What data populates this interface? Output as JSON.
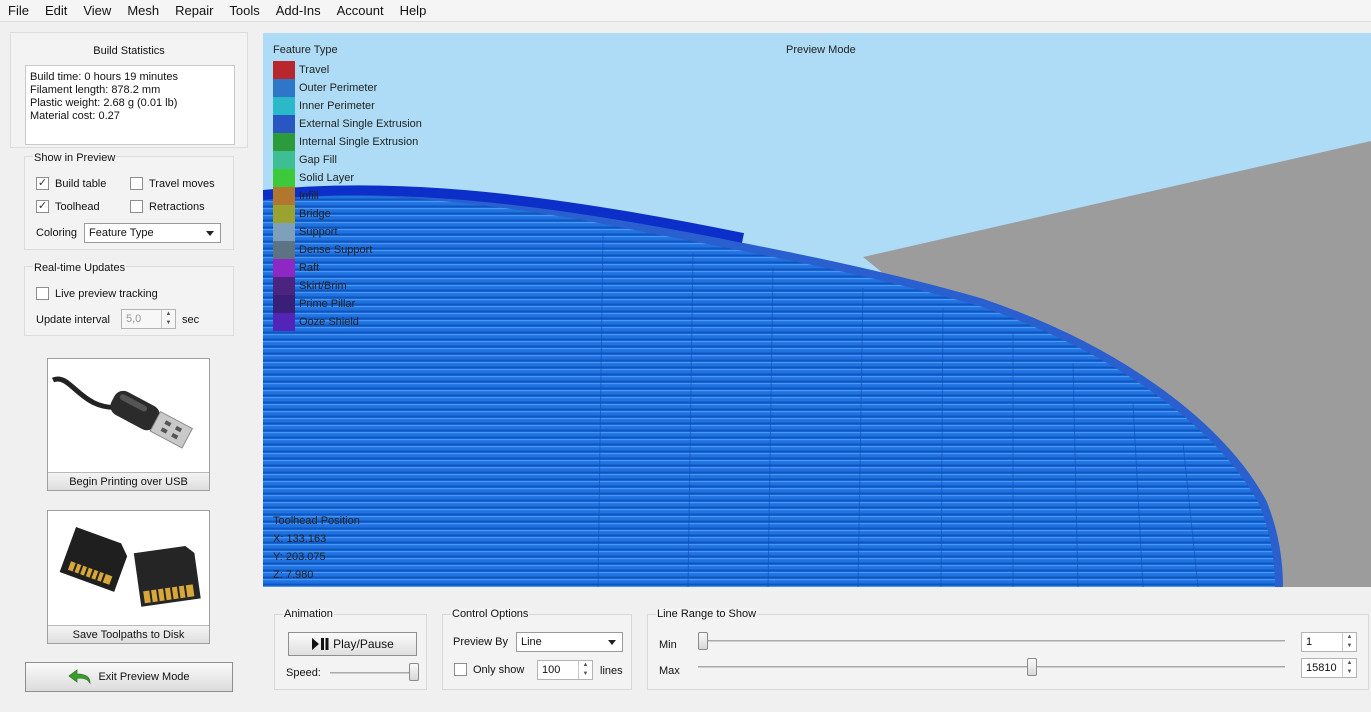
{
  "menu": [
    "File",
    "Edit",
    "View",
    "Mesh",
    "Repair",
    "Tools",
    "Add-Ins",
    "Account",
    "Help"
  ],
  "build_stats": {
    "title": "Build Statistics",
    "lines": [
      "Build time: 0 hours 19 minutes",
      "Filament length: 878.2 mm",
      "Plastic weight: 2.68 g (0.01 lb)",
      "Material cost: 0.27"
    ]
  },
  "show_in_preview": {
    "title": "Show in Preview",
    "build_table": {
      "label": "Build table",
      "checked": true
    },
    "travel_moves": {
      "label": "Travel moves",
      "checked": false
    },
    "toolhead": {
      "label": "Toolhead",
      "checked": true
    },
    "retractions": {
      "label": "Retractions",
      "checked": false
    },
    "coloring_label": "Coloring",
    "coloring_value": "Feature Type"
  },
  "realtime": {
    "title": "Real-time Updates",
    "live_label": "Live preview tracking",
    "live_checked": false,
    "interval_label": "Update interval",
    "interval_value": "5,0",
    "interval_unit": "sec"
  },
  "usb_button": {
    "label": "Begin Printing over USB",
    "icon": "usb-cable-icon"
  },
  "disk_button": {
    "label": "Save Toolpaths to Disk",
    "icon": "sd-card-icon"
  },
  "exit_button": {
    "label": "Exit Preview Mode",
    "icon": "back-arrow-icon"
  },
  "viewport": {
    "legend_title": "Feature Type",
    "mode_label": "Preview Mode",
    "legend": [
      {
        "label": "Travel",
        "color": "#b8272e"
      },
      {
        "label": "Outer Perimeter",
        "color": "#2f76c8"
      },
      {
        "label": "Inner Perimeter",
        "color": "#2bb8c8"
      },
      {
        "label": "External Single Extrusion",
        "color": "#2a56c4"
      },
      {
        "label": "Internal Single Extrusion",
        "color": "#2c9b3c"
      },
      {
        "label": "Gap Fill",
        "color": "#3dbf93"
      },
      {
        "label": "Solid Layer",
        "color": "#3dc93a"
      },
      {
        "label": "Infill",
        "color": "#b3762e"
      },
      {
        "label": "Bridge",
        "color": "#9aa331"
      },
      {
        "label": "Support",
        "color": "#7ea0b8"
      },
      {
        "label": "Dense Support",
        "color": "#5d7383"
      },
      {
        "label": "Raft",
        "color": "#8e28c4"
      },
      {
        "label": "Skirt/Brim",
        "color": "#4a247e"
      },
      {
        "label": "Prime Pillar",
        "color": "#3a1f78"
      },
      {
        "label": "Ooze Shield",
        "color": "#5224b8"
      }
    ],
    "toolhead": {
      "title": "Toolhead Position",
      "x": "X: 133.163",
      "y": "Y: 203.075",
      "z": "Z: 7.980"
    }
  },
  "animation": {
    "title": "Animation",
    "play_label": "Play/Pause",
    "speed_label": "Speed:",
    "speed_level": 1.0
  },
  "control_options": {
    "title": "Control Options",
    "preview_by_label": "Preview By",
    "preview_by_value": "Line",
    "only_show_label": "Only show",
    "only_show_checked": false,
    "only_show_value": "100",
    "only_show_unit": "lines"
  },
  "line_range": {
    "title": "Line Range to Show",
    "min_label": "Min",
    "max_label": "Max",
    "min_value": "1",
    "max_value": "15810",
    "min_level": 0.0,
    "max_level": 0.57
  }
}
